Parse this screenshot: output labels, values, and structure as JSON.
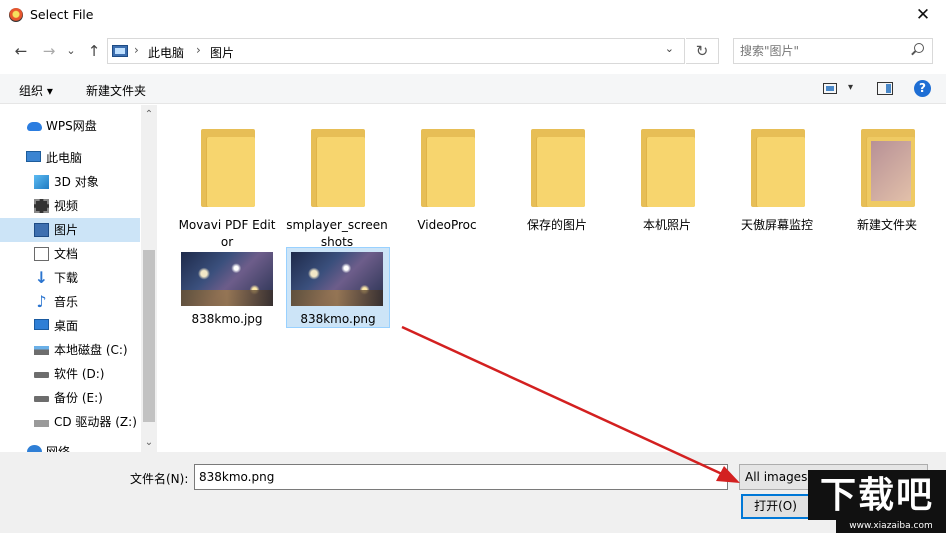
{
  "window": {
    "title": "Select File",
    "close_glyph": "✕"
  },
  "nav": {
    "back": "←",
    "forward": "→",
    "recent": "⌄",
    "up": "↑"
  },
  "address": {
    "crumbs": [
      "此电脑",
      "图片"
    ],
    "sep": "›",
    "dropdown": "⌄",
    "refresh": "↻"
  },
  "search": {
    "placeholder": "搜索\"图片\""
  },
  "toolbar": {
    "organize": "组织 ▾",
    "new_folder": "新建文件夹",
    "view_dd": "▾",
    "help": "?"
  },
  "sidebar": {
    "items": [
      {
        "label": "WPS网盘",
        "icon": "cloud-icon"
      },
      {
        "label": "此电脑",
        "icon": "pc-icon"
      },
      {
        "label": "3D 对象",
        "icon": "3d-objects-icon"
      },
      {
        "label": "视频",
        "icon": "video-icon"
      },
      {
        "label": "图片",
        "icon": "pictures-icon"
      },
      {
        "label": "文档",
        "icon": "documents-icon"
      },
      {
        "label": "下载",
        "icon": "download-icon"
      },
      {
        "label": "音乐",
        "icon": "music-icon"
      },
      {
        "label": "桌面",
        "icon": "desktop-icon"
      },
      {
        "label": "本地磁盘 (C:)",
        "icon": "drive-icon"
      },
      {
        "label": "软件 (D:)",
        "icon": "drive-icon"
      },
      {
        "label": "备份 (E:)",
        "icon": "drive-icon"
      },
      {
        "label": "CD 驱动器 (Z:)",
        "icon": "cd-drive-icon"
      },
      {
        "label": "网络",
        "icon": "network-icon"
      }
    ],
    "scroll_up": "⌃",
    "scroll_down": "⌄"
  },
  "files": {
    "folders": [
      {
        "label": "Movavi PDF Editor"
      },
      {
        "label": "smplayer_screenshots"
      },
      {
        "label": "VideoProc"
      },
      {
        "label": "保存的图片"
      },
      {
        "label": "本机照片"
      },
      {
        "label": "天傲屏幕监控"
      },
      {
        "label": "新建文件夹"
      }
    ],
    "images": [
      {
        "label": "838kmo.jpg"
      },
      {
        "label": "838kmo.png"
      }
    ]
  },
  "footer": {
    "filename_label": "文件名(N):",
    "filename_value": "838kmo.png",
    "filter_value": "All images (*.jpg;*.jpeg;*.tif;*.",
    "filter_dd": "▾",
    "open_button": "打开(O)"
  },
  "watermark": {
    "main": "下载吧",
    "sub": "www.xiazaiba.com"
  },
  "colors": {
    "selection": "#cce4f7",
    "accent": "#0078d7",
    "arrow": "#d32020",
    "folder": "#f7d56e"
  }
}
